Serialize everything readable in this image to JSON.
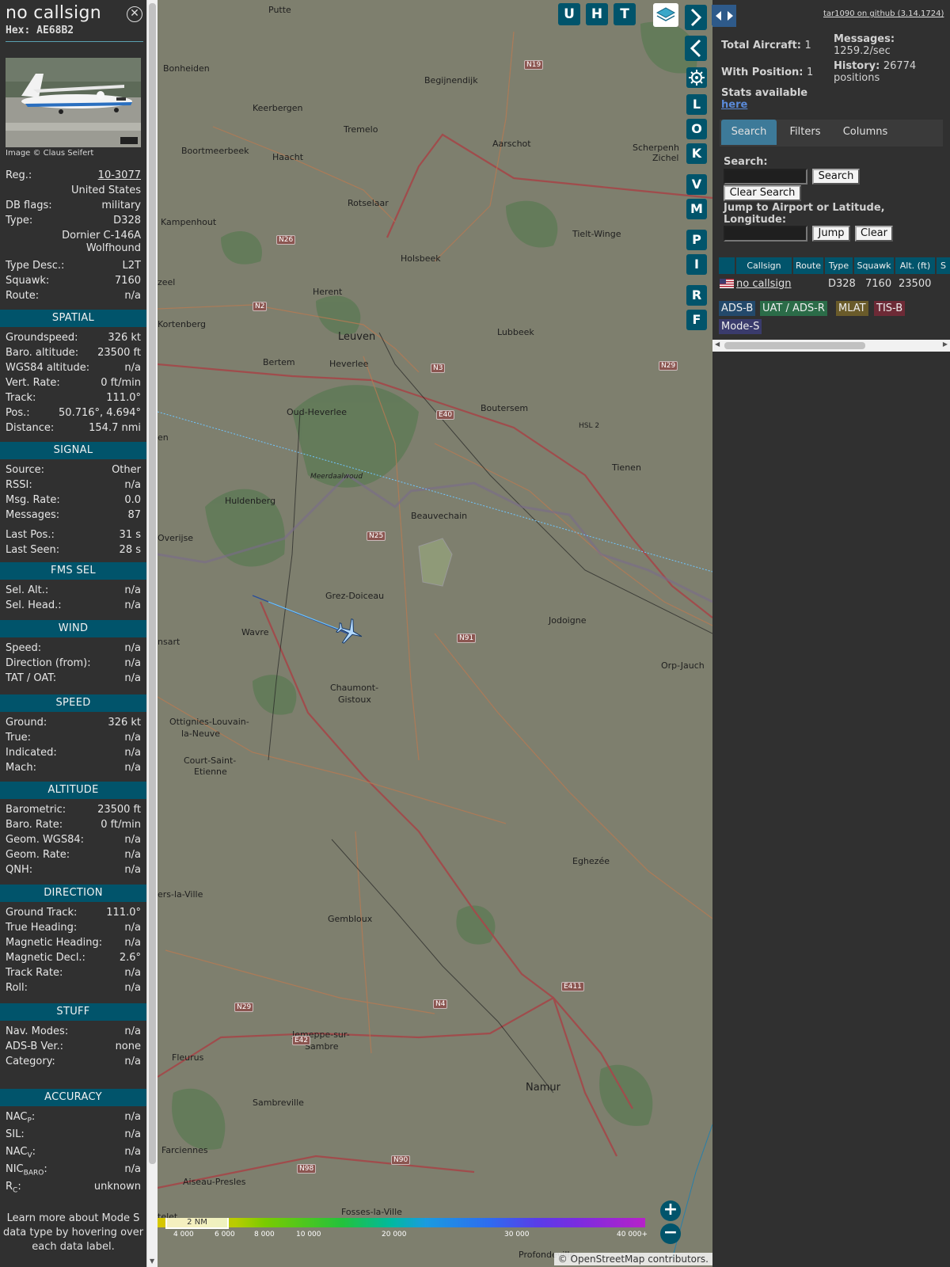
{
  "selected": {
    "callsign": "no callsign",
    "hex_label": "Hex:",
    "hex": "AE68B2",
    "photo_credit": "Image © Claus Seifert",
    "reg_label": "Reg.:",
    "reg": "10-3077",
    "country": "United States",
    "dbflags_label": "DB flags:",
    "dbflags": "military",
    "type_label": "Type:",
    "type": "D328",
    "type_name_1": "Dornier C-146A",
    "type_name_2": "Wolfhound",
    "type_desc_label": "Type Desc.:",
    "type_desc": "L2T",
    "squawk_label": "Squawk:",
    "squawk": "7160",
    "route_label": "Route:",
    "route": "n/a"
  },
  "sections": {
    "spatial": {
      "title": "SPATIAL",
      "rows": [
        {
          "k": "Groundspeed:",
          "v": "326 kt"
        },
        {
          "k": "Baro. altitude:",
          "v": "23500 ft"
        },
        {
          "k": "WGS84 altitude:",
          "v": "n/a"
        },
        {
          "k": "Vert. Rate:",
          "v": "0 ft/min"
        },
        {
          "k": "Track:",
          "v": "111.0°"
        },
        {
          "k": "Pos.:",
          "v": "50.716°, 4.694°"
        },
        {
          "k": "Distance:",
          "v": "154.7 nmi"
        }
      ]
    },
    "signal": {
      "title": "SIGNAL",
      "rows": [
        {
          "k": "Source:",
          "v": "Other"
        },
        {
          "k": "RSSI:",
          "v": "n/a"
        },
        {
          "k": "Msg. Rate:",
          "v": "0.0"
        },
        {
          "k": "Messages:",
          "v": "87"
        },
        {
          "k": "Last Pos.:",
          "v": "31 s"
        },
        {
          "k": "Last Seen:",
          "v": "28 s"
        }
      ]
    },
    "fms": {
      "title": "FMS SEL",
      "rows": [
        {
          "k": "Sel. Alt.:",
          "v": "n/a"
        },
        {
          "k": "Sel. Head.:",
          "v": "n/a"
        }
      ]
    },
    "wind": {
      "title": "WIND",
      "rows": [
        {
          "k": "Speed:",
          "v": "n/a"
        },
        {
          "k": "Direction (from):",
          "v": "n/a"
        },
        {
          "k": "TAT / OAT:",
          "v": "n/a"
        }
      ]
    },
    "speed": {
      "title": "SPEED",
      "rows": [
        {
          "k": "Ground:",
          "v": "326 kt"
        },
        {
          "k": "True:",
          "v": "n/a"
        },
        {
          "k": "Indicated:",
          "v": "n/a"
        },
        {
          "k": "Mach:",
          "v": "n/a"
        }
      ]
    },
    "altitude": {
      "title": "ALTITUDE",
      "rows": [
        {
          "k": "Barometric:",
          "v": "23500 ft"
        },
        {
          "k": "Baro. Rate:",
          "v": "0 ft/min"
        },
        {
          "k": "Geom. WGS84:",
          "v": "n/a"
        },
        {
          "k": "Geom. Rate:",
          "v": "n/a"
        },
        {
          "k": "QNH:",
          "v": "n/a"
        }
      ]
    },
    "direction": {
      "title": "DIRECTION",
      "rows": [
        {
          "k": "Ground Track:",
          "v": "111.0°"
        },
        {
          "k": "True Heading:",
          "v": "n/a"
        },
        {
          "k": "Magnetic Heading:",
          "v": "n/a"
        },
        {
          "k": "Magnetic Decl.:",
          "v": "2.6°"
        },
        {
          "k": "Track Rate:",
          "v": "n/a"
        },
        {
          "k": "Roll:",
          "v": "n/a"
        }
      ]
    },
    "stuff": {
      "title": "STUFF",
      "rows": [
        {
          "k": "Nav. Modes:",
          "v": "n/a"
        },
        {
          "k": "ADS-B Ver.:",
          "v": "none"
        },
        {
          "k": "Category:",
          "v": "n/a"
        }
      ]
    },
    "accuracy": {
      "title": "ACCURACY",
      "rows": [
        {
          "k": "NAC",
          "sub": "P",
          "k2": ":",
          "v": "n/a"
        },
        {
          "k": "SIL:",
          "sub": "",
          "k2": "",
          "v": "n/a"
        },
        {
          "k": "NAC",
          "sub": "V",
          "k2": ":",
          "v": "n/a"
        },
        {
          "k": "NIC",
          "sub": "BARO",
          "k2": ":",
          "v": "n/a"
        },
        {
          "k": "R",
          "sub": "C",
          "k2": ":",
          "v": "unknown"
        }
      ]
    },
    "footnote": "Learn more about Mode S data type by hovering over each data label."
  },
  "map": {
    "toolbar": [
      "U",
      "H",
      "T"
    ],
    "side_buttons": [
      "L",
      "O",
      "K",
      "V",
      "M",
      "P",
      "I",
      "R",
      "F"
    ],
    "zoom_in": "+",
    "zoom_out": "−",
    "scale": "2 NM",
    "attribution_prefix": "©",
    "attribution_link": "OpenStreetMap",
    "attribution_suffix": "contributors.",
    "altitude_labels": [
      "4 000",
      "6 000",
      "8 000",
      "10 000",
      "20 000",
      "30 000",
      "40 000+"
    ],
    "places": [
      {
        "n": "Putte"
      },
      {
        "n": "Bonheiden"
      },
      {
        "n": "Begijnendijk"
      },
      {
        "n": "Keerbergen"
      },
      {
        "n": "Tremelo"
      },
      {
        "n": "Aarschot"
      },
      {
        "n": "Scherpenh"
      },
      {
        "n": "Zichel"
      },
      {
        "n": "Boortmeerbeek"
      },
      {
        "n": "Haacht"
      },
      {
        "n": "Rotselaar"
      },
      {
        "n": "Kampenhout"
      },
      {
        "n": "Tielt-Winge"
      },
      {
        "n": "Holsbeek"
      },
      {
        "n": "Herent"
      },
      {
        "n": "zeel"
      },
      {
        "n": "Kortenberg"
      },
      {
        "n": "Leuven"
      },
      {
        "n": "Lubbeek"
      },
      {
        "n": "Bertem"
      },
      {
        "n": "Heverlee"
      },
      {
        "n": "Oud-Heverlee"
      },
      {
        "n": "Boutersem"
      },
      {
        "n": "Tienen"
      },
      {
        "n": "Meerdaalwoud"
      },
      {
        "n": "Huldenberg"
      },
      {
        "n": "Beauvechain"
      },
      {
        "n": "Overijse"
      },
      {
        "n": "Grez-Doiceau"
      },
      {
        "n": "Wavre"
      },
      {
        "n": "Jodoigne"
      },
      {
        "n": "Orp-Jauch"
      },
      {
        "n": "Chaumont-"
      },
      {
        "n": "Gistoux"
      },
      {
        "n": "Ottignies-Louvain-"
      },
      {
        "n": "la-Neuve"
      },
      {
        "n": "Court-Saint-"
      },
      {
        "n": "Etienne"
      },
      {
        "n": "Eghezée"
      },
      {
        "n": "Gembloux"
      },
      {
        "n": "ers-la-Ville"
      },
      {
        "n": "Fleurus"
      },
      {
        "n": "Jemeppe-sur-"
      },
      {
        "n": "Sambre"
      },
      {
        "n": "Namur"
      },
      {
        "n": "Sambreville"
      },
      {
        "n": "Farciennes"
      },
      {
        "n": "Aiseau-Presles"
      },
      {
        "n": "Fosses-la-Ville"
      },
      {
        "n": "Profondeville"
      },
      {
        "n": "telet"
      },
      {
        "n": "nsart"
      },
      {
        "n": "en"
      }
    ],
    "roads": [
      "N19",
      "N26",
      "N2",
      "N3",
      "N29",
      "E40",
      "N25",
      "N91",
      "E411",
      "N4",
      "N29",
      "E42",
      "N98",
      "N90",
      "HSL 2"
    ]
  },
  "right": {
    "github": "tar1090 on github (3.14.1724)",
    "total_label": "Total Aircraft:",
    "total": "1",
    "withpos_label": "With Position:",
    "withpos": "1",
    "stats_label": "Stats available",
    "stats_link": "here",
    "messages_label": "Messages:",
    "messages": "1259.2/sec",
    "history_label": "History:",
    "history": "26774 positions",
    "tabs": [
      "Search",
      "Filters",
      "Columns"
    ],
    "search_label": "Search:",
    "search_button": "Search",
    "clear_search_button": "Clear Search",
    "jump_label": "Jump to Airport or Latitude, Longitude:",
    "jump_button": "Jump",
    "clear_button": "Clear",
    "columns": [
      "Callsign",
      "Route",
      "Type",
      "Squawk",
      "Alt. (ft)",
      "S"
    ],
    "row": {
      "callsign": "no callsign",
      "route": "",
      "type": "D328",
      "squawk": "7160",
      "alt": "23500"
    },
    "badges": [
      {
        "label": "ADS-B",
        "color": "#23496b"
      },
      {
        "label": "UAT / ADS-R",
        "color": "#2b6c48"
      },
      {
        "label": "MLAT",
        "color": "#6a5b2a"
      },
      {
        "label": "TIS-B",
        "color": "#6d2a36"
      },
      {
        "label": "Mode-S",
        "color": "#3a3b6c"
      }
    ]
  },
  "colors": {
    "accent": "#01546b",
    "tab_active": "#3d7a99",
    "track": "#6fc6ff"
  }
}
